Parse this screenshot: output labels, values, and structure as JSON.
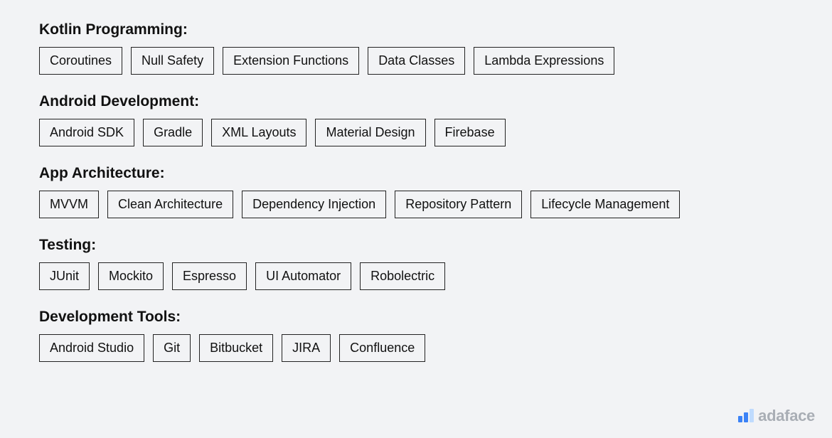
{
  "sections": [
    {
      "title": "Kotlin Programming:",
      "tags": [
        "Coroutines",
        "Null Safety",
        "Extension Functions",
        "Data Classes",
        "Lambda Expressions"
      ]
    },
    {
      "title": "Android Development:",
      "tags": [
        "Android SDK",
        "Gradle",
        "XML Layouts",
        "Material Design",
        "Firebase"
      ]
    },
    {
      "title": "App Architecture:",
      "tags": [
        "MVVM",
        "Clean Architecture",
        "Dependency Injection",
        "Repository Pattern",
        "Lifecycle Management"
      ]
    },
    {
      "title": "Testing:",
      "tags": [
        "JUnit",
        "Mockito",
        "Espresso",
        "UI Automator",
        "Robolectric"
      ]
    },
    {
      "title": "Development Tools:",
      "tags": [
        "Android Studio",
        "Git",
        "Bitbucket",
        "JIRA",
        "Confluence"
      ]
    }
  ],
  "brand": {
    "name": "adaface"
  }
}
